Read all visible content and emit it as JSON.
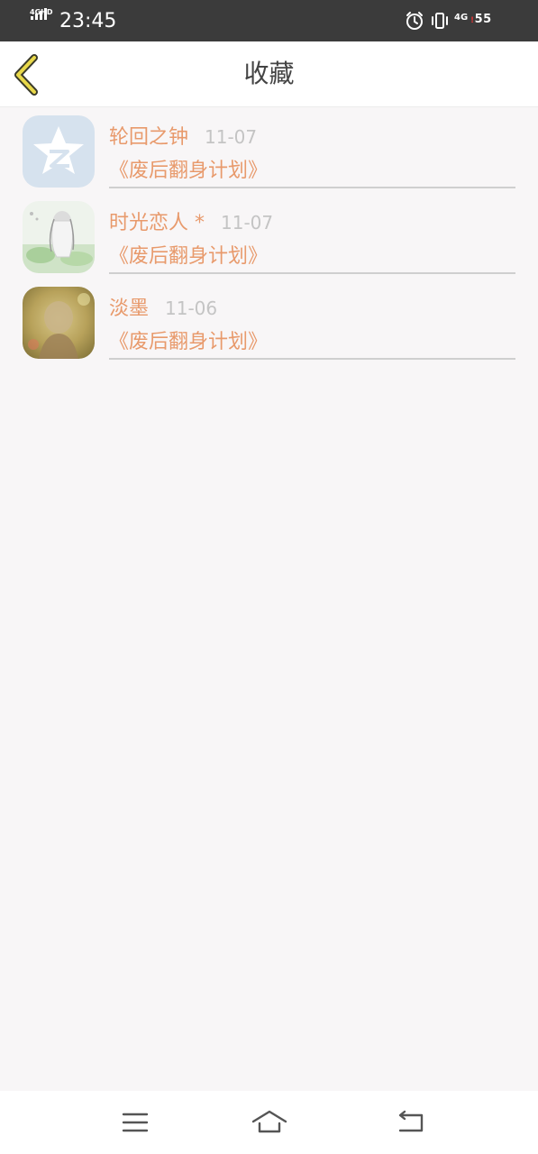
{
  "status_bar": {
    "network_left": "4GHD",
    "time": "23:45",
    "network_right": "4G",
    "battery_warning": "!",
    "battery": "55"
  },
  "header": {
    "title": "收藏"
  },
  "favorites": [
    {
      "name": "轮回之钟",
      "date": "11-07",
      "book": "《废后翻身计划》",
      "avatar": "qzone-logo-avatar"
    },
    {
      "name": "时光恋人 *",
      "date": "11-07",
      "book": "《废后翻身计划》",
      "avatar": "anime-girl-avatar"
    },
    {
      "name": "淡墨",
      "date": "11-06",
      "book": "《废后翻身计划》",
      "avatar": "blurred-photo-avatar"
    }
  ],
  "colors": {
    "accent": "#e89a6c",
    "date": "#c4c4c4",
    "background": "#f8f6f7",
    "status_bar": "#3b3b3b",
    "back_arrow": "#e8d84a"
  },
  "nav_bar": {
    "icons": [
      "menu-icon",
      "home-icon",
      "back-icon"
    ]
  }
}
